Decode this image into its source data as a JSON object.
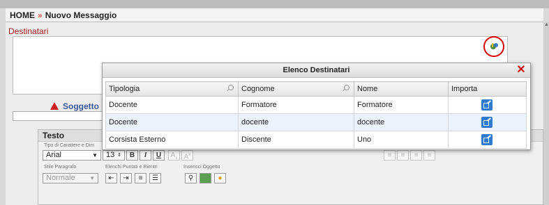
{
  "breadcrumb": {
    "home": "HOME",
    "separator": "»",
    "current": "Nuovo Messaggio"
  },
  "form": {
    "recipients_label": "Destinatari",
    "recipients_add_icon": "add-recipient-icon",
    "subject_label": "Soggetto",
    "text_label": "Testo"
  },
  "toolbar": {
    "font_group_label": "Tipo di Carattere e Dim",
    "font_value": "Arial",
    "font_size_value": "13",
    "paragraph_group_label": "Stile Paragrafo",
    "paragraph_value": "Normale",
    "lists_group_label": "Elenchi Puntati e Rientri",
    "insert_group_label": "Inserisci Oggetto",
    "bold": "B",
    "italic": "I",
    "underline": "U"
  },
  "modal": {
    "title": "Elenco Destinatari",
    "columns": [
      "Tipologia",
      "Cognome",
      "Nome",
      "Importa"
    ],
    "rows": [
      {
        "tipologia": "Docente",
        "cognome": "Formatore",
        "nome": "Formatore"
      },
      {
        "tipologia": "Docente",
        "cognome": "docente",
        "nome": "docente"
      },
      {
        "tipologia": "Corsista Esterno",
        "cognome": "Discente",
        "nome": "Uno"
      }
    ]
  },
  "colors": {
    "accent_red": "#d80000",
    "link_blue": "#3a5a9a",
    "import_blue": "#2f7ad0"
  }
}
